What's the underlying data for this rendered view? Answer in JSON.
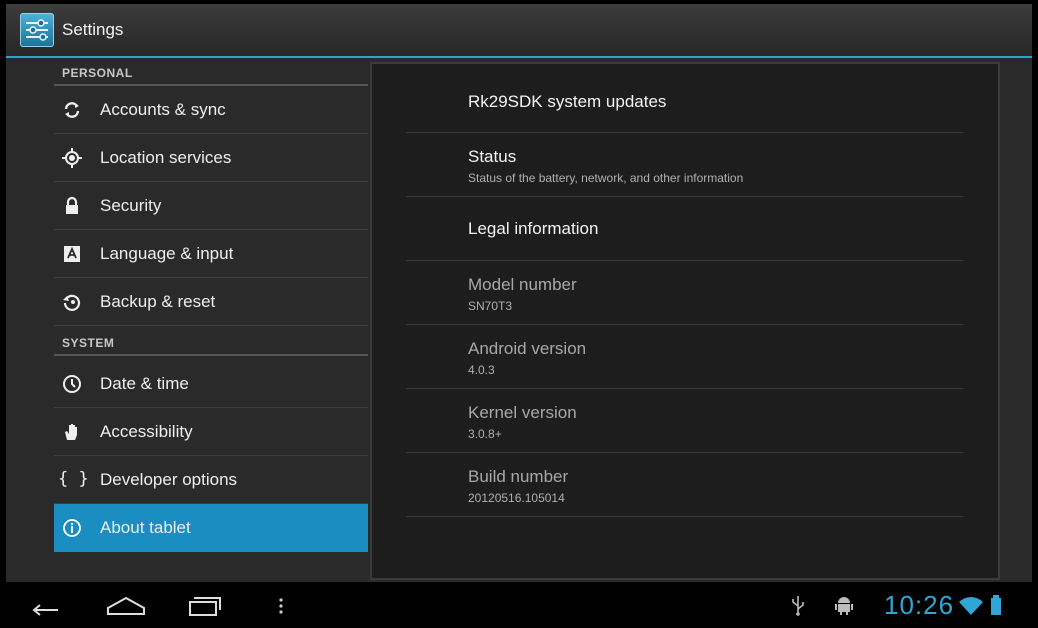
{
  "app": {
    "title": "Settings"
  },
  "sidebar": {
    "personal_header": "PERSONAL",
    "system_header": "SYSTEM",
    "personal_items": [
      {
        "label": "Accounts & sync",
        "icon": "sync-icon"
      },
      {
        "label": "Location services",
        "icon": "location-icon"
      },
      {
        "label": "Security",
        "icon": "lock-icon"
      },
      {
        "label": "Language & input",
        "icon": "keyboard-icon"
      },
      {
        "label": "Backup & reset",
        "icon": "backup-icon"
      }
    ],
    "system_items": [
      {
        "label": "Date & time",
        "icon": "clock-icon"
      },
      {
        "label": "Accessibility",
        "icon": "hand-icon"
      },
      {
        "label": "Developer options",
        "icon": "braces-icon"
      },
      {
        "label": "About tablet",
        "icon": "info-icon",
        "selected": true
      }
    ]
  },
  "about": {
    "items": [
      {
        "title": "Rk29SDK system updates",
        "summary": "",
        "enabled": true
      },
      {
        "title": "Status",
        "summary": "Status of the battery, network, and other information",
        "enabled": true
      },
      {
        "title": "Legal information",
        "summary": "",
        "enabled": true
      },
      {
        "title": "Model number",
        "summary": "SN70T3",
        "enabled": false
      },
      {
        "title": "Android version",
        "summary": "4.0.3",
        "enabled": false
      },
      {
        "title": "Kernel version",
        "summary": "3.0.8+",
        "enabled": false
      },
      {
        "title": "Build number",
        "summary": "20120516.105014",
        "enabled": false
      }
    ]
  },
  "status_bar": {
    "time": "10:26"
  },
  "colors": {
    "accent": "#1a8ec0",
    "clock": "#2fa6d4"
  }
}
